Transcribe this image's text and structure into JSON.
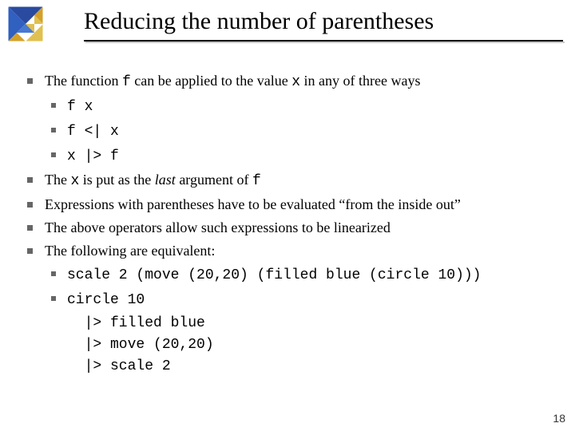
{
  "title": "Reducing the number of parentheses",
  "pagenum": "18",
  "line1_a": "The function ",
  "line1_b": "f",
  "line1_c": " can be applied to the value ",
  "line1_d": "x",
  "line1_e": " in any of three ways",
  "sub1": "f x",
  "sub2": "f <| x",
  "sub3": "x |> f",
  "line2_a": "The ",
  "line2_b": "x",
  "line2_c": " is put as the ",
  "line2_d": "last",
  "line2_e": " argument of ",
  "line2_f": "f",
  "line3": "Expressions with parentheses have to be evaluated “from the inside out”",
  "line4": "The above operators allow such expressions to be linearized",
  "line5": "The following are equivalent:",
  "code1": "scale 2 (move (20,20) (filled blue (circle 10)))",
  "code2a": "circle 10",
  "code2b": "  |> filled blue",
  "code2c": "  |> move (20,20)",
  "code2d": "  |> scale 2"
}
